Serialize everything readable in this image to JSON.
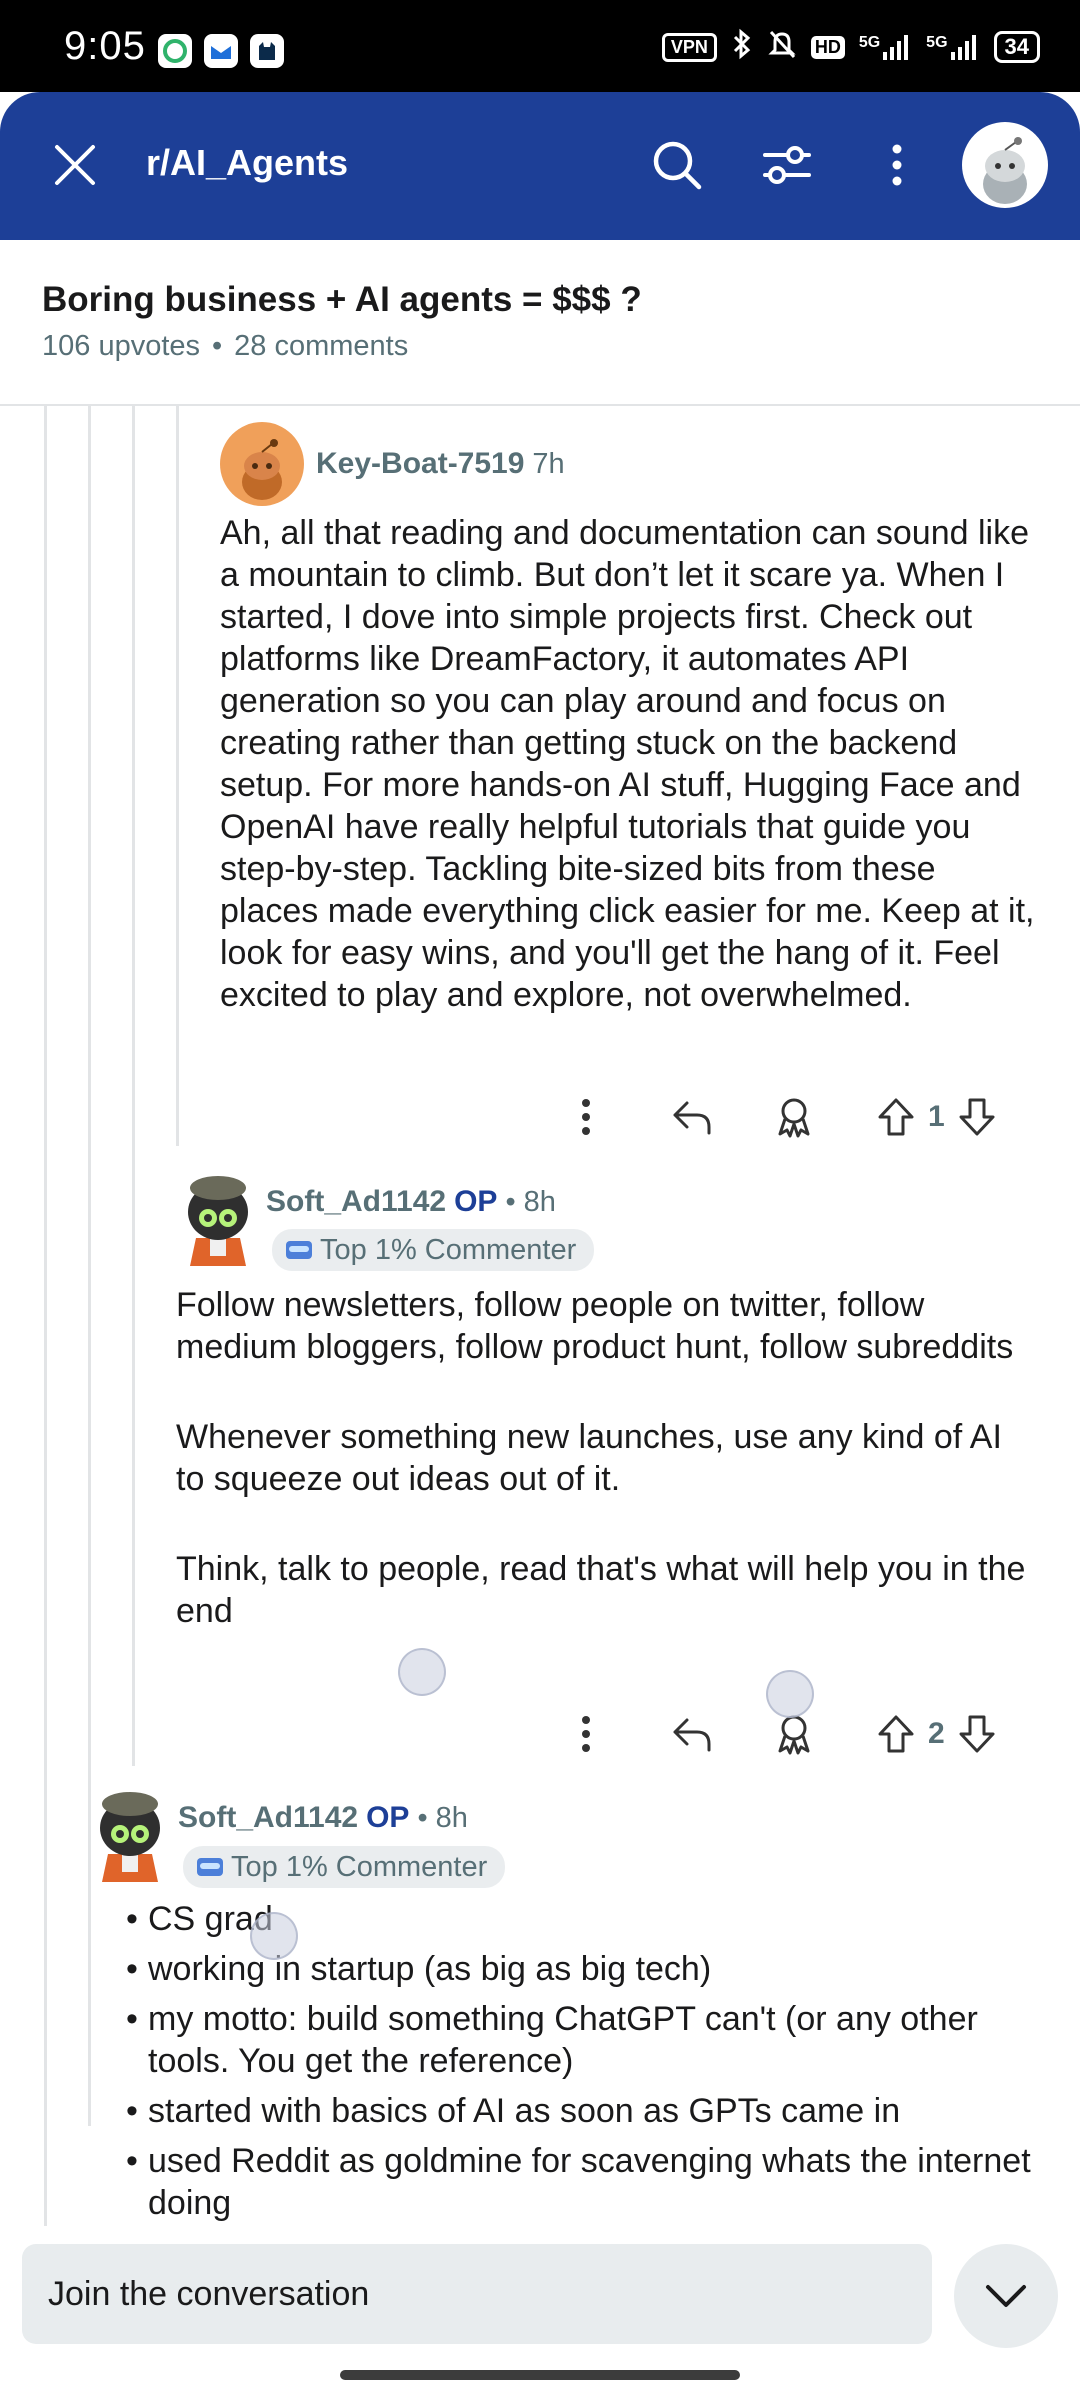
{
  "status_bar": {
    "time": "9:05",
    "vpn": "VPN",
    "hd": "HD",
    "net1": "5G",
    "net2": "5G",
    "battery": "34"
  },
  "header": {
    "subreddit": "r/AI_Agents",
    "color": "#1d3f97",
    "icons": [
      "close-icon",
      "search-icon",
      "filter-icon",
      "more-icon",
      "avatar"
    ]
  },
  "post": {
    "title": "Boring business + AI agents = $$$ ?",
    "upvotes": "106 upvotes",
    "separator": "•",
    "comments": "28 comments"
  },
  "comments": [
    {
      "author": "Key-Boat-7519",
      "time": "7h",
      "body": "Ah, all that reading and documentation can sound like a mountain to climb. But don’t let it scare ya. When I started, I dove into simple projects first. Check out platforms like DreamFactory, it automates API generation so you can play around and focus on creating rather than getting stuck on the backend setup. For more hands-on AI stuff, Hugging Face and OpenAI have really helpful tutorials that guide you step-by-step. Tackling bite-sized bits from these places made everything click easier for me. Keep at it, look for easy wins, and you'll get the hang of it. Feel excited to play and explore, not overwhelmed.",
      "score": "1"
    },
    {
      "author": "Soft_Ad1142",
      "op": "OP",
      "time": "• 8h",
      "flair": "Top 1% Commenter",
      "paragraphs": [
        "Follow newsletters, follow people on twitter, follow medium bloggers, follow product hunt, follow subreddits",
        "Whenever something new launches, use any kind of AI to squeeze out ideas out of it.",
        "Think, talk to people, read that's what will help you in the end"
      ],
      "score": "2"
    },
    {
      "author": "Soft_Ad1142",
      "op": "OP",
      "time": "• 8h",
      "flair": "Top 1% Commenter",
      "bullets": [
        "CS grad",
        "working in startup (as big as big tech)",
        "my motto: build something ChatGPT can't (or any other tools. You get the reference)",
        "started with basics of AI as soon as GPTs came in",
        "used Reddit as goldmine for scavenging whats the internet doing"
      ]
    }
  ],
  "composer": {
    "placeholder": "Join the conversation"
  }
}
